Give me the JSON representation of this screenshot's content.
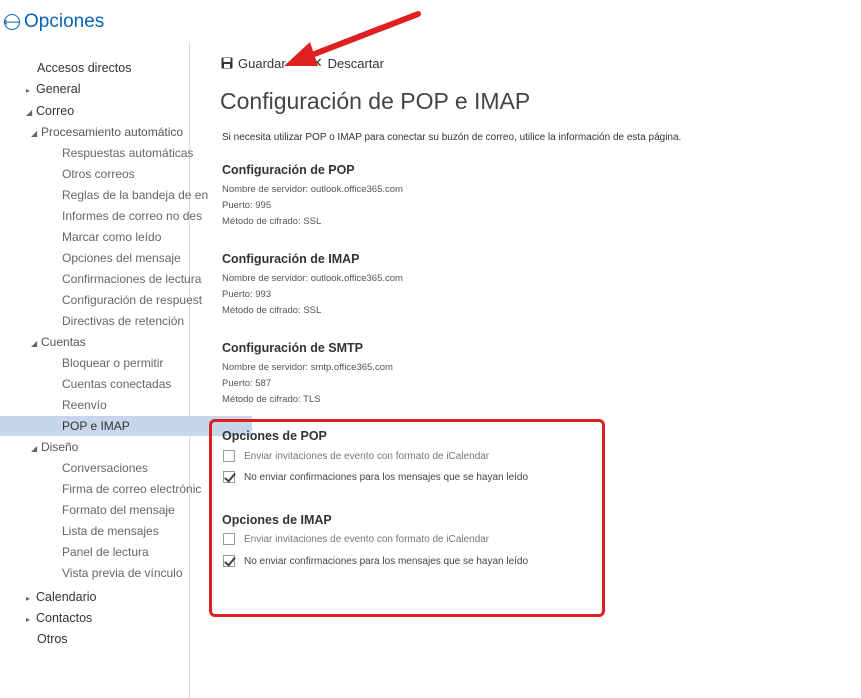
{
  "header": {
    "back_glyph": "⟵",
    "title": "Opciones"
  },
  "sidebar": {
    "items": [
      {
        "label": "Accesos directos",
        "level": 0,
        "tri": "",
        "selected": false
      },
      {
        "label": "General",
        "level": 0,
        "tri": "▸",
        "selected": false
      },
      {
        "label": "Correo",
        "level": 0,
        "tri": "◢",
        "selected": false
      },
      {
        "label": "Procesamiento automático",
        "level": 1,
        "tri": "◢",
        "selected": false
      },
      {
        "label": "Respuestas automáticas",
        "level": 2,
        "tri": "",
        "selected": false
      },
      {
        "label": "Otros correos",
        "level": 2,
        "tri": "",
        "selected": false
      },
      {
        "label": "Reglas de la bandeja de en",
        "level": 2,
        "tri": "",
        "selected": false
      },
      {
        "label": "Informes de correo no des",
        "level": 2,
        "tri": "",
        "selected": false
      },
      {
        "label": "Marcar como leído",
        "level": 2,
        "tri": "",
        "selected": false
      },
      {
        "label": "Opciones del mensaje",
        "level": 2,
        "tri": "",
        "selected": false
      },
      {
        "label": "Confirmaciones de lectura",
        "level": 2,
        "tri": "",
        "selected": false
      },
      {
        "label": "Configuración de respuest",
        "level": 2,
        "tri": "",
        "selected": false
      },
      {
        "label": "Directivas de retención",
        "level": 2,
        "tri": "",
        "selected": false
      },
      {
        "label": "Cuentas",
        "level": 1,
        "tri": "◢",
        "selected": false
      },
      {
        "label": "Bloquear o permitir",
        "level": 2,
        "tri": "",
        "selected": false
      },
      {
        "label": "Cuentas conectadas",
        "level": 2,
        "tri": "",
        "selected": false
      },
      {
        "label": "Reenvío",
        "level": 2,
        "tri": "",
        "selected": false
      },
      {
        "label": "POP e IMAP",
        "level": 2,
        "tri": "",
        "selected": true
      },
      {
        "label": "Diseño",
        "level": 1,
        "tri": "◢",
        "selected": false
      },
      {
        "label": "Conversaciones",
        "level": 2,
        "tri": "",
        "selected": false
      },
      {
        "label": "Firma de correo electrónic",
        "level": 2,
        "tri": "",
        "selected": false
      },
      {
        "label": "Formato del mensaje",
        "level": 2,
        "tri": "",
        "selected": false
      },
      {
        "label": "Lista de mensajes",
        "level": 2,
        "tri": "",
        "selected": false
      },
      {
        "label": "Panel de lectura",
        "level": 2,
        "tri": "",
        "selected": false
      },
      {
        "label": "Vista previa de vínculo",
        "level": 2,
        "tri": "",
        "selected": false
      },
      {
        "label": "Calendario",
        "level": 0,
        "tri": "▸",
        "selected": false
      },
      {
        "label": "Contactos",
        "level": 0,
        "tri": "▸",
        "selected": false
      },
      {
        "label": "Otros",
        "level": 0,
        "tri": "",
        "selected": false
      }
    ]
  },
  "toolbar": {
    "save_label": "Guardar",
    "discard_label": "Descartar",
    "discard_glyph": "✕"
  },
  "main": {
    "title": "Configuración de POP e IMAP",
    "intro": "Si necesita utilizar POP o IMAP para conectar su buzón de correo, utilice la información de esta página.",
    "pop": {
      "title": "Configuración de POP",
      "server": "Nombre de servidor: outlook.office365.com",
      "port": "Puerto: 995",
      "encryption": "Método de cifrado: SSL"
    },
    "imap": {
      "title": "Configuración de IMAP",
      "server": "Nombre de servidor: outlook.office365.com",
      "port": "Puerto: 993",
      "encryption": "Método de cifrado: SSL"
    },
    "smtp": {
      "title": "Configuración de SMTP",
      "server": "Nombre de servidor: smtp.office365.com",
      "port": "Puerto: 587",
      "encryption": "Método de cifrado: TLS"
    },
    "pop_options": {
      "title": "Opciones de POP",
      "icalendar_label": "Enviar invitaciones de evento con formato de iCalendar",
      "icalendar_checked": false,
      "no_receipts_label": "No enviar confirmaciones para los mensajes que se hayan leído",
      "no_receipts_checked": true
    },
    "imap_options": {
      "title": "Opciones de IMAP",
      "icalendar_label": "Enviar invitaciones de evento con formato de iCalendar",
      "icalendar_checked": false,
      "no_receipts_label": "No enviar confirmaciones para los mensajes que se hayan leído",
      "no_receipts_checked": true
    }
  },
  "colors": {
    "accent": "#0a63b8",
    "selected_bg": "#c7d6ea",
    "highlight_red": "#e02020"
  }
}
